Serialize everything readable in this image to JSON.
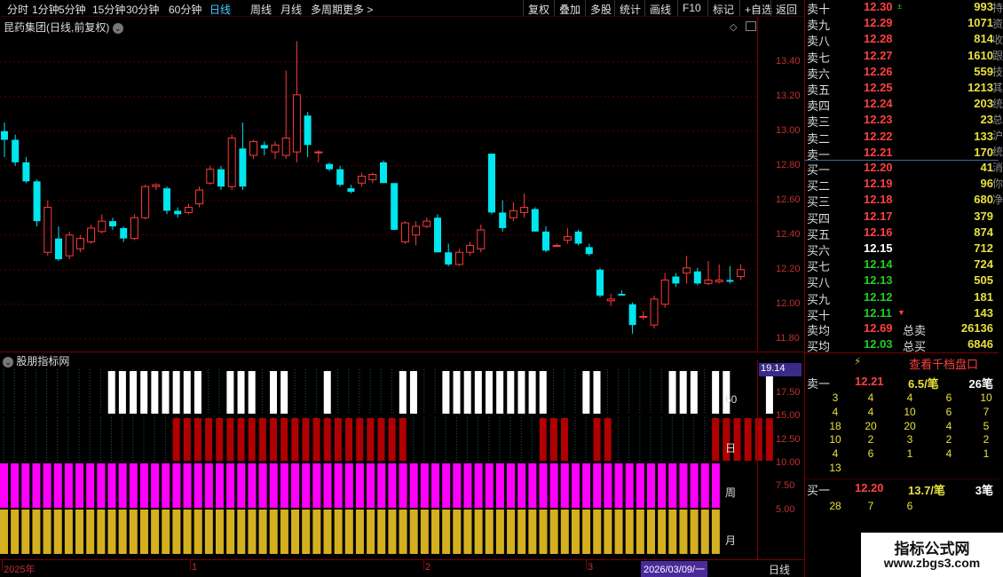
{
  "toolbar": {
    "items": [
      "分时",
      "1分钟",
      "5分钟",
      "15分钟",
      "30分钟",
      "60分钟",
      "日线",
      "周线",
      "月线",
      "多周期",
      "更多 >"
    ],
    "active": "日线",
    "right": [
      "复权",
      "叠加",
      "多股",
      "统计",
      "画线",
      "F10",
      "标记",
      "+自选",
      "返回"
    ]
  },
  "stock": {
    "title": "昆药集团(日线,前复权)"
  },
  "price_axis": [
    "13.40",
    "13.20",
    "13.00",
    "12.80",
    "12.60",
    "12.40",
    "12.20",
    "12.00",
    "11.80"
  ],
  "candles": [
    [
      13.0,
      13.05,
      12.85,
      12.95
    ],
    [
      12.95,
      12.98,
      12.8,
      12.82
    ],
    [
      12.82,
      12.85,
      12.7,
      12.71
    ],
    [
      12.71,
      12.72,
      12.45,
      12.48
    ],
    [
      12.3,
      12.6,
      12.28,
      12.56
    ],
    [
      12.38,
      12.45,
      12.25,
      12.26
    ],
    [
      12.28,
      12.42,
      12.26,
      12.4
    ],
    [
      12.32,
      12.4,
      12.3,
      12.38
    ],
    [
      12.36,
      12.46,
      12.35,
      12.44
    ],
    [
      12.42,
      12.52,
      12.41,
      12.48
    ],
    [
      12.48,
      12.5,
      12.43,
      12.45
    ],
    [
      12.44,
      12.45,
      12.36,
      12.38
    ],
    [
      12.38,
      12.52,
      12.37,
      12.5
    ],
    [
      12.5,
      12.69,
      12.49,
      12.68
    ],
    [
      12.68,
      12.7,
      12.66,
      12.69
    ],
    [
      12.67,
      12.68,
      12.52,
      12.54
    ],
    [
      12.54,
      12.56,
      12.5,
      12.52
    ],
    [
      12.53,
      12.58,
      12.52,
      12.56
    ],
    [
      12.58,
      12.68,
      12.56,
      12.66
    ],
    [
      12.7,
      12.8,
      12.69,
      12.78
    ],
    [
      12.78,
      12.8,
      12.66,
      12.68
    ],
    [
      12.68,
      12.98,
      12.66,
      12.96
    ],
    [
      12.9,
      13.05,
      12.66,
      12.68
    ],
    [
      12.86,
      12.95,
      12.84,
      12.94
    ],
    [
      12.92,
      12.94,
      12.86,
      12.9
    ],
    [
      12.88,
      12.94,
      12.84,
      12.92
    ],
    [
      12.86,
      13.35,
      12.84,
      12.96
    ],
    [
      12.88,
      13.52,
      12.82,
      13.21
    ],
    [
      13.09,
      13.11,
      12.85,
      12.92
    ],
    [
      12.88,
      12.89,
      12.82,
      12.88
    ],
    [
      12.81,
      12.82,
      12.77,
      12.78
    ],
    [
      12.78,
      12.8,
      12.68,
      12.69
    ],
    [
      12.67,
      12.69,
      12.64,
      12.65
    ],
    [
      12.7,
      12.76,
      12.68,
      12.74
    ],
    [
      12.72,
      12.76,
      12.7,
      12.75
    ],
    [
      12.82,
      12.83,
      12.7,
      12.7
    ],
    [
      12.7,
      12.7,
      12.43,
      12.43
    ],
    [
      12.36,
      12.48,
      12.35,
      12.47
    ],
    [
      12.4,
      12.48,
      12.34,
      12.45
    ],
    [
      12.45,
      12.5,
      12.44,
      12.48
    ],
    [
      12.5,
      12.52,
      12.3,
      12.3
    ],
    [
      12.3,
      12.35,
      12.22,
      12.23
    ],
    [
      12.23,
      12.32,
      12.22,
      12.3
    ],
    [
      12.3,
      12.36,
      12.28,
      12.34
    ],
    [
      12.32,
      12.46,
      12.3,
      12.43
    ],
    [
      12.87,
      12.87,
      12.52,
      12.53
    ],
    [
      12.53,
      12.6,
      12.42,
      12.44
    ],
    [
      12.5,
      12.59,
      12.48,
      12.54
    ],
    [
      12.53,
      12.64,
      12.5,
      12.56
    ],
    [
      12.55,
      12.56,
      12.42,
      12.42
    ],
    [
      12.42,
      12.45,
      12.3,
      12.31
    ],
    [
      12.34,
      12.35,
      12.33,
      12.34
    ],
    [
      12.37,
      12.44,
      12.35,
      12.39
    ],
    [
      12.42,
      12.43,
      12.34,
      12.35
    ],
    [
      12.33,
      12.35,
      12.28,
      12.29
    ],
    [
      12.2,
      12.21,
      12.04,
      12.05
    ],
    [
      12.02,
      12.06,
      11.99,
      12.03
    ],
    [
      12.06,
      12.08,
      12.05,
      12.05
    ],
    [
      12.0,
      12.01,
      11.83,
      11.88
    ],
    [
      11.93,
      11.96,
      11.91,
      11.93
    ],
    [
      11.88,
      12.05,
      11.86,
      12.03
    ],
    [
      12.0,
      12.18,
      11.98,
      12.14
    ],
    [
      12.16,
      12.18,
      12.1,
      12.12
    ],
    [
      12.18,
      12.28,
      12.12,
      12.21
    ],
    [
      12.19,
      12.21,
      12.11,
      12.12
    ],
    [
      12.12,
      12.25,
      12.11,
      12.14
    ],
    [
      12.13,
      12.23,
      12.12,
      12.14
    ],
    [
      12.14,
      12.22,
      12.12,
      12.13
    ],
    [
      12.16,
      12.23,
      12.14,
      12.2
    ]
  ],
  "indicator": {
    "title": "股朋指标网",
    "current_value": "19.14",
    "axis": [
      "17.50",
      "15.00",
      "12.50",
      "10.00",
      "7.50",
      "5.00"
    ],
    "row_labels": [
      "60",
      "日",
      "周",
      "月"
    ],
    "row60": [
      0,
      0,
      0,
      0,
      0,
      1,
      1,
      1,
      1,
      1,
      1,
      1,
      1,
      1,
      0,
      0,
      1,
      1,
      1,
      0,
      1,
      1,
      0,
      0,
      0,
      1,
      0,
      0,
      0,
      0,
      0,
      0,
      1,
      1,
      0,
      0,
      1,
      1,
      1,
      1,
      1,
      1,
      1,
      1,
      1,
      1,
      0,
      0,
      0,
      1,
      1,
      0,
      0,
      0,
      0,
      0,
      0,
      1,
      1,
      1,
      0,
      1,
      1,
      0,
      0,
      0,
      1
    ],
    "rowDay": [
      0,
      0,
      0,
      0,
      0,
      0,
      0,
      0,
      0,
      0,
      0,
      1,
      1,
      1,
      1,
      1,
      1,
      1,
      1,
      1,
      1,
      1,
      1,
      1,
      1,
      1,
      1,
      1,
      1,
      1,
      1,
      1,
      1,
      0,
      0,
      0,
      0,
      0,
      0,
      0,
      0,
      0,
      0,
      0,
      0,
      1,
      1,
      1,
      0,
      0,
      1,
      1,
      0,
      0,
      0,
      0,
      0,
      0,
      0,
      0,
      0,
      1,
      1,
      1,
      1,
      1,
      1
    ]
  },
  "dates": {
    "labels": [
      "2025年",
      "1",
      "2",
      "3",
      "2026/03/09/一"
    ],
    "period": "日线"
  },
  "orderbook": {
    "sells": [
      {
        "label": "卖十",
        "price": "12.30",
        "vol": "993",
        "mark": "±"
      },
      {
        "label": "卖九",
        "price": "12.29",
        "vol": "1071"
      },
      {
        "label": "卖八",
        "price": "12.28",
        "vol": "814"
      },
      {
        "label": "卖七",
        "price": "12.27",
        "vol": "1610"
      },
      {
        "label": "卖六",
        "price": "12.26",
        "vol": "559"
      },
      {
        "label": "卖五",
        "price": "12.25",
        "vol": "1213"
      },
      {
        "label": "卖四",
        "price": "12.24",
        "vol": "203"
      },
      {
        "label": "卖三",
        "price": "12.23",
        "vol": "23"
      },
      {
        "label": "卖二",
        "price": "12.22",
        "vol": "133"
      },
      {
        "label": "卖一",
        "price": "12.21",
        "vol": "170"
      }
    ],
    "buys": [
      {
        "label": "买一",
        "price": "12.20",
        "vol": "41",
        "color": "red"
      },
      {
        "label": "买二",
        "price": "12.19",
        "vol": "96",
        "color": "red"
      },
      {
        "label": "买三",
        "price": "12.18",
        "vol": "680",
        "color": "red"
      },
      {
        "label": "买四",
        "price": "12.17",
        "vol": "379",
        "color": "red"
      },
      {
        "label": "买五",
        "price": "12.16",
        "vol": "874",
        "color": "red"
      },
      {
        "label": "买六",
        "price": "12.15",
        "vol": "712",
        "color": "white"
      },
      {
        "label": "买七",
        "price": "12.14",
        "vol": "724",
        "color": "green"
      },
      {
        "label": "买八",
        "price": "12.13",
        "vol": "505",
        "color": "green"
      },
      {
        "label": "买九",
        "price": "12.12",
        "vol": "181",
        "color": "green"
      },
      {
        "label": "买十",
        "price": "12.11",
        "vol": "143",
        "color": "green",
        "mark": "▼"
      }
    ],
    "avg_sell": {
      "label": "卖均",
      "price": "12.69",
      "total_label": "总卖",
      "total": "26136"
    },
    "avg_buy": {
      "label": "买均",
      "price": "12.03",
      "total_label": "总买",
      "total": "6846"
    },
    "thousand_btn": "查看千档盘口",
    "sell1": {
      "label": "卖一",
      "price": "12.21",
      "per": "6.5/笔",
      "count": "26笔"
    },
    "sell1_grid": [
      [
        "3",
        "4",
        "4",
        "6",
        "10"
      ],
      [
        "4",
        "4",
        "10",
        "6",
        "7"
      ],
      [
        "18",
        "20",
        "20",
        "4",
        "5"
      ],
      [
        "10",
        "2",
        "3",
        "2",
        "2"
      ],
      [
        "4",
        "6",
        "1",
        "4",
        "1"
      ],
      [
        "13",
        "",
        "",
        "",
        ""
      ]
    ],
    "buy1": {
      "label": "买一",
      "price": "12.20",
      "per": "13.7/笔",
      "count": "3笔"
    },
    "buy1_grid": [
      [
        "28",
        "7",
        "6"
      ]
    ],
    "side_strip": "持资收跟技其统总沪统消你净"
  },
  "watermark": {
    "title": "指标公式网",
    "url": "www.zbgs3.com"
  }
}
